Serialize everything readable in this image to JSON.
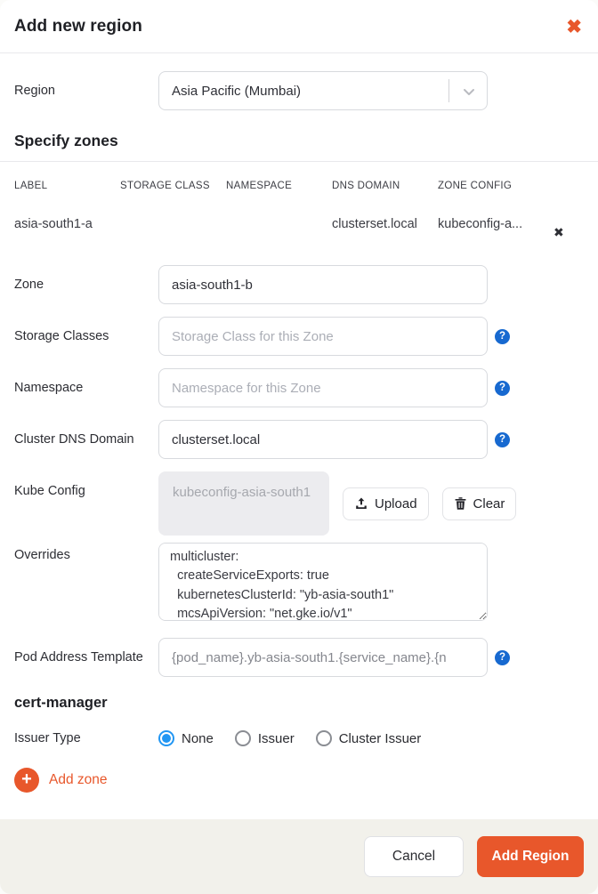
{
  "modal": {
    "title": "Add new region"
  },
  "icons": {
    "close": "✖",
    "remove_row": "✖",
    "help": "?",
    "plus": "+"
  },
  "region": {
    "label": "Region",
    "value": "Asia Pacific (Mumbai)"
  },
  "zones_section": {
    "heading": "Specify zones",
    "table": {
      "headers": [
        "LABEL",
        "STORAGE CLASS",
        "NAMESPACE",
        "DNS DOMAIN",
        "ZONE CONFIG"
      ],
      "rows": [
        {
          "label": "asia-south1-a",
          "storage_class": "",
          "namespace": "",
          "dns_domain": "clusterset.local",
          "zone_config": "kubeconfig-a..."
        }
      ]
    }
  },
  "zone_form": {
    "zone": {
      "label": "Zone",
      "value": "asia-south1-b"
    },
    "storage_classes": {
      "label": "Storage Classes",
      "placeholder": "Storage Class for this Zone"
    },
    "namespace": {
      "label": "Namespace",
      "placeholder": "Namespace for this Zone"
    },
    "dns_domain": {
      "label": "Cluster DNS Domain",
      "value": "clusterset.local"
    },
    "kube_config": {
      "label": "Kube Config",
      "file_name": "kubeconfig-asia-south1",
      "upload_label": "Upload",
      "clear_label": "Clear"
    },
    "overrides": {
      "label": "Overrides",
      "value": "multicluster:\n  createServiceExports: true\n  kubernetesClusterId: \"yb-asia-south1\"\n  mcsApiVersion: \"net.gke.io/v1\""
    },
    "pod_address_template": {
      "label": "Pod Address Template",
      "value": "{pod_name}.yb-asia-south1.{service_name}.{n"
    },
    "cert_manager_heading": "cert-manager",
    "issuer_type": {
      "label": "Issuer Type",
      "options": [
        {
          "label": "None",
          "selected": true
        },
        {
          "label": "Issuer",
          "selected": false
        },
        {
          "label": "Cluster Issuer",
          "selected": false
        }
      ]
    },
    "add_zone_label": "Add zone"
  },
  "footer": {
    "cancel_label": "Cancel",
    "add_region_label": "Add Region"
  },
  "colors": {
    "accent_orange": "#e8572b",
    "help_blue": "#1769d0",
    "radio_blue": "#2196f3",
    "footer_bg": "#f2f1eb"
  }
}
